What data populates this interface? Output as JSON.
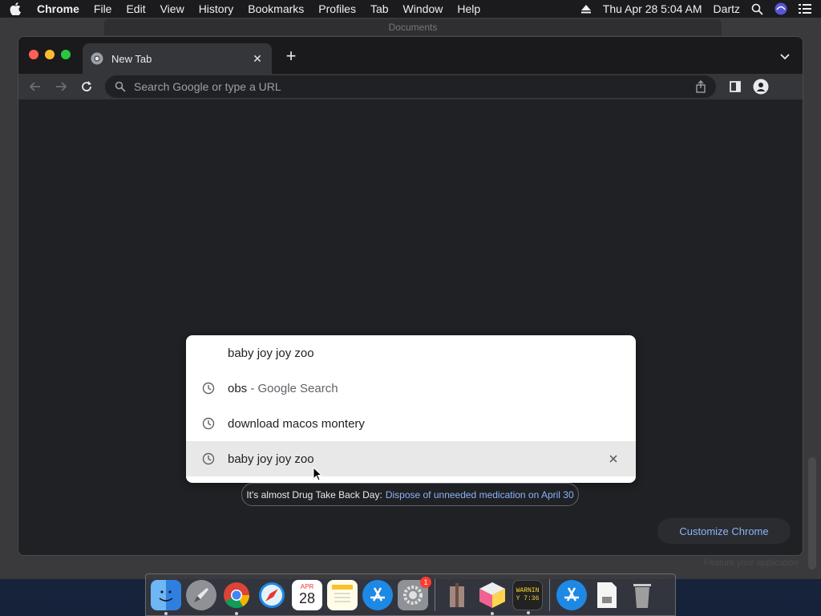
{
  "menubar": {
    "app_name": "Chrome",
    "items": [
      "File",
      "Edit",
      "View",
      "History",
      "Bookmarks",
      "Profiles",
      "Tab",
      "Window",
      "Help"
    ],
    "datetime": "Thu Apr 28  5:04 AM",
    "user": "Dartz"
  },
  "background_window": {
    "title": "Documents"
  },
  "chrome": {
    "tab": {
      "title": "New Tab"
    },
    "omnibox": {
      "placeholder": "Search Google or type a URL"
    },
    "dropdown": {
      "input_text": "baby joy joy zoo",
      "suggestions": [
        {
          "text": "obs",
          "suffix": " - Google Search",
          "icon": "clock-icon"
        },
        {
          "text": "download macos montery",
          "suffix": "",
          "icon": "clock-icon"
        },
        {
          "text": "baby joy joy zoo",
          "suffix": "",
          "icon": "clock-icon",
          "highlighted": true
        }
      ]
    },
    "promo": {
      "text": "It's almost Drug Take Back Day:",
      "link": "Dispose of unneeded medication on April 30"
    },
    "customize_label": "Customize Chrome"
  },
  "desktop": {
    "feature_text": "Feature your application"
  },
  "dock": {
    "calendar_month": "APR",
    "calendar_day": "28",
    "settings_badge": "1",
    "console_text_1": "WARNIN",
    "console_text_2": "Y 7:36"
  },
  "colors": {
    "accent": "#8ab4f8",
    "window_bg": "#202124",
    "toolbar_bg": "#35363a"
  }
}
